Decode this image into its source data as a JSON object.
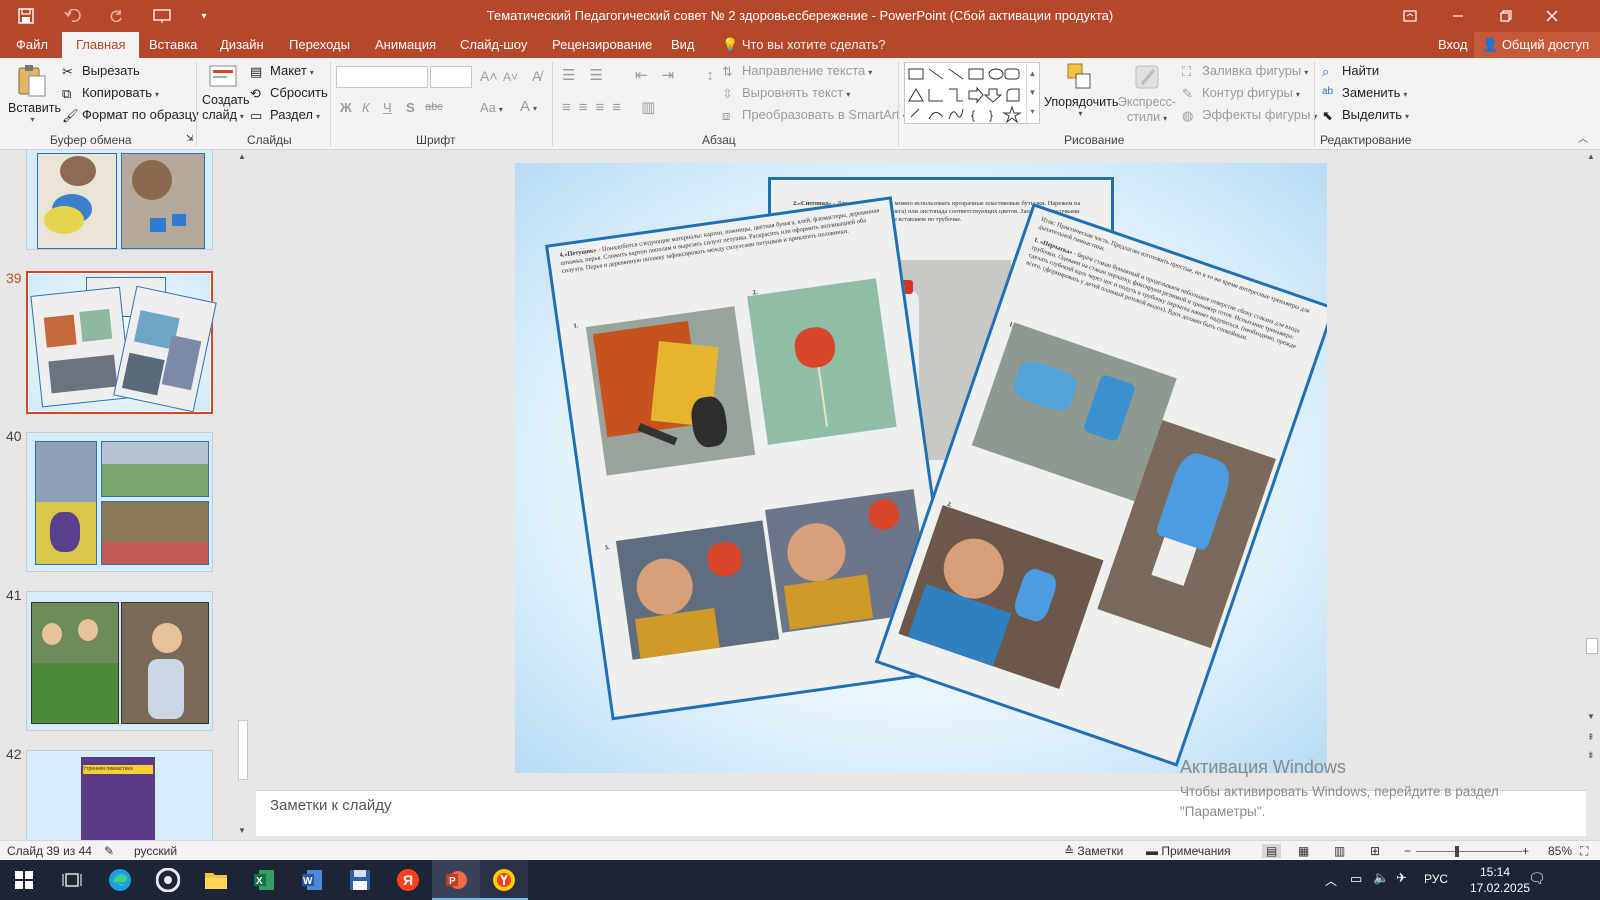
{
  "window": {
    "title": "Тематический Педагогический совет № 2 здоровьесбережение - PowerPoint (Сбой активации продукта)"
  },
  "menu": {
    "file": "Файл",
    "tabs": [
      "Главная",
      "Вставка",
      "Дизайн",
      "Переходы",
      "Анимация",
      "Слайд-шоу",
      "Рецензирование",
      "Вид"
    ],
    "tell_me": "Что вы хотите сделать?",
    "sign_in": "Вход",
    "share": "Общий доступ"
  },
  "ribbon": {
    "clipboard": {
      "label": "Буфер обмена",
      "paste": "Вставить",
      "cut": "Вырезать",
      "copy": "Копировать",
      "format_painter": "Формат по образцу"
    },
    "slides": {
      "label": "Слайды",
      "new_slide_1": "Создать",
      "new_slide_2": "слайд",
      "layout": "Макет",
      "reset": "Сбросить",
      "section": "Раздел"
    },
    "font": {
      "label": "Шрифт",
      "bold": "Ж",
      "italic": "К",
      "underline": "Ч",
      "shadow": "S",
      "strike": "abc",
      "case": "Aa",
      "color": "A"
    },
    "paragraph": {
      "label": "Абзац",
      "text_direction": "Направление текста",
      "align_text": "Выровнять текст",
      "smartart": "Преобразовать в SmartArt"
    },
    "drawing": {
      "label": "Рисование",
      "arrange": "Упорядочить",
      "quick_styles_1": "Экспресс-",
      "quick_styles_2": "стили",
      "shape_fill": "Заливка фигуры",
      "shape_outline": "Контур фигуры",
      "shape_effects": "Эффекты фигуры"
    },
    "editing": {
      "label": "Редактирование",
      "find": "Найти",
      "replace": "Заменить",
      "select": "Выделить"
    }
  },
  "thumbnails": [
    {
      "num": "39"
    },
    {
      "num": "40"
    },
    {
      "num": "41"
    },
    {
      "num": "42",
      "caption": "Утренняя гимнастика"
    }
  ],
  "slide": {
    "paper_left_heading": "4.«Петушок»",
    "paper_left_text": "- Понадобится следующие материалы: картон, ножницы, цветная бумага, клей, фломастеры, деревянная шпажка, перья. Сложить картон пополам и вырезать силуэт петушка. Раскрасить или оформить аппликацией оба силуэта. Перья и деревянную шпажку зафиксировать между силуэтами петушков и приклеить половинки.",
    "paper_left_labels": [
      "1.",
      "2.",
      "3."
    ],
    "paper_back_heading": "2.«Снегопад»",
    "paper_back_text": "- Для этого тренажера можно использовать прозрачные пластиковые бутылки. Нарежем на мелкие кусочки белую бумагу (для снега) или листопада соответствующих цветов. Заполняем кусочками бутылку. Делаем несколько дырочек и вставляем по трубочке.",
    "paper_right_intro": "Итак: Практическая часть. Предлагаю изготовить простые, но в то же время интересные тренажеры для дыхательной гимнастики.",
    "paper_right_heading": "1. «Перчатка»",
    "paper_right_text": "- берём стакан бумажный и проделываем небольшое отверстие сбоку стакана для входа трубочки. Одеваем на стакан перчатку, фиксируем резинкой и тренажер готов. Испытание тренажера: сделать глубокий вдох через нос и подуть в трубочку перчатка начнет надуваться. (необходимо, прежде всего, сформировать у детей плавный ротовой выдох). Вдох должен быть спокойным.",
    "paper_right_labels": [
      "1.",
      "2."
    ]
  },
  "notes": {
    "placeholder": "Заметки к слайду"
  },
  "status": {
    "slide_info": "Слайд 39 из 44",
    "language": "русский",
    "notes": "Заметки",
    "comments": "Примечания",
    "zoom": "85%"
  },
  "activation": {
    "title": "Активация Windows",
    "text": "Чтобы активировать Windows, перейдите в раздел \"Параметры\"."
  },
  "taskbar": {
    "apps": [
      "start-icon",
      "task-view-icon",
      "edge-icon",
      "chrome-icon",
      "file-explorer-icon",
      "excel-icon",
      "word-icon",
      "floppy-app-icon",
      "yandex-icon",
      "powerpoint-icon",
      "yandex-browser-icon"
    ],
    "lang": "РУС",
    "time": "15:14",
    "date": "17.02.2025"
  },
  "colors": {
    "accent": "#b7472a",
    "selection": "#d24726",
    "paper_border": "#1f6fb5",
    "taskbar": "#1c2436"
  }
}
